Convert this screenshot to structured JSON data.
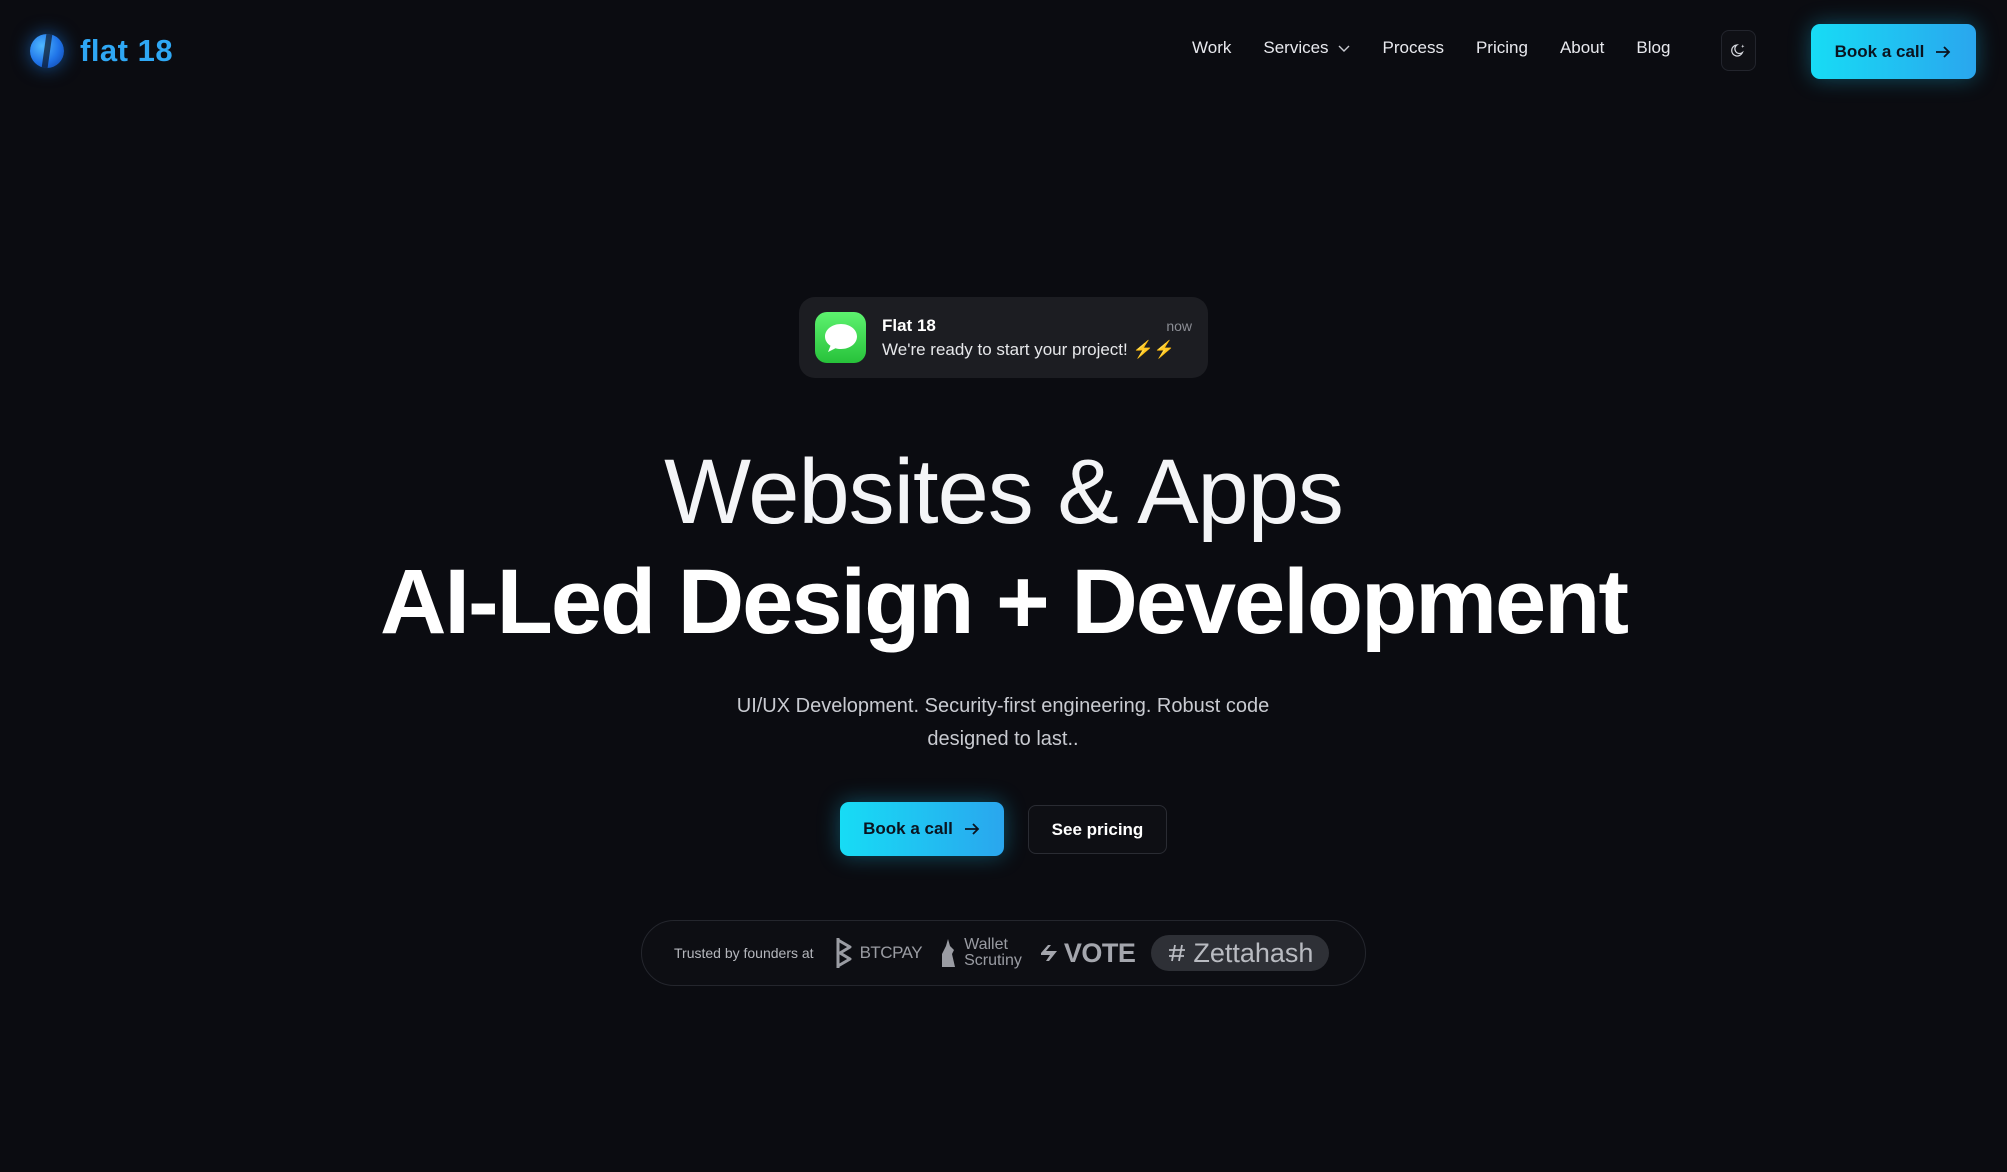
{
  "brand": {
    "name": "flat 18",
    "logo_icon": "globe-logo-icon",
    "accent": "#2fa8f5"
  },
  "nav": {
    "items": [
      {
        "label": "Work"
      },
      {
        "label": "Services",
        "has_dropdown": true
      },
      {
        "label": "Process"
      },
      {
        "label": "Pricing"
      },
      {
        "label": "About"
      },
      {
        "label": "Blog"
      }
    ],
    "theme_toggle_icon": "moon-icon",
    "cta_label": "Book a call"
  },
  "notification": {
    "app": "Flat 18",
    "time": "now",
    "message": "We're ready to start your project! ⚡⚡",
    "icon": "messages-icon"
  },
  "hero": {
    "line1": "Websites & Apps",
    "line2": "AI-Led Design + Development",
    "subtitle": "UI/UX Development. Security-first engineering. Robust code designed to last..",
    "primary_cta": "Book a call",
    "secondary_cta": "See pricing"
  },
  "trust": {
    "label": "Trusted by founders at",
    "logos": [
      {
        "name": "BTCPAY"
      },
      {
        "name_line1": "Wallet",
        "name_line2": "Scrutiny"
      },
      {
        "name": "VOTE"
      },
      {
        "name": "Zettahash"
      }
    ]
  },
  "colors": {
    "background": "#0b0c11",
    "cta_gradient_start": "#17dcf5",
    "cta_gradient_end": "#2aa6ee",
    "notification_green": "#3bd24c"
  }
}
